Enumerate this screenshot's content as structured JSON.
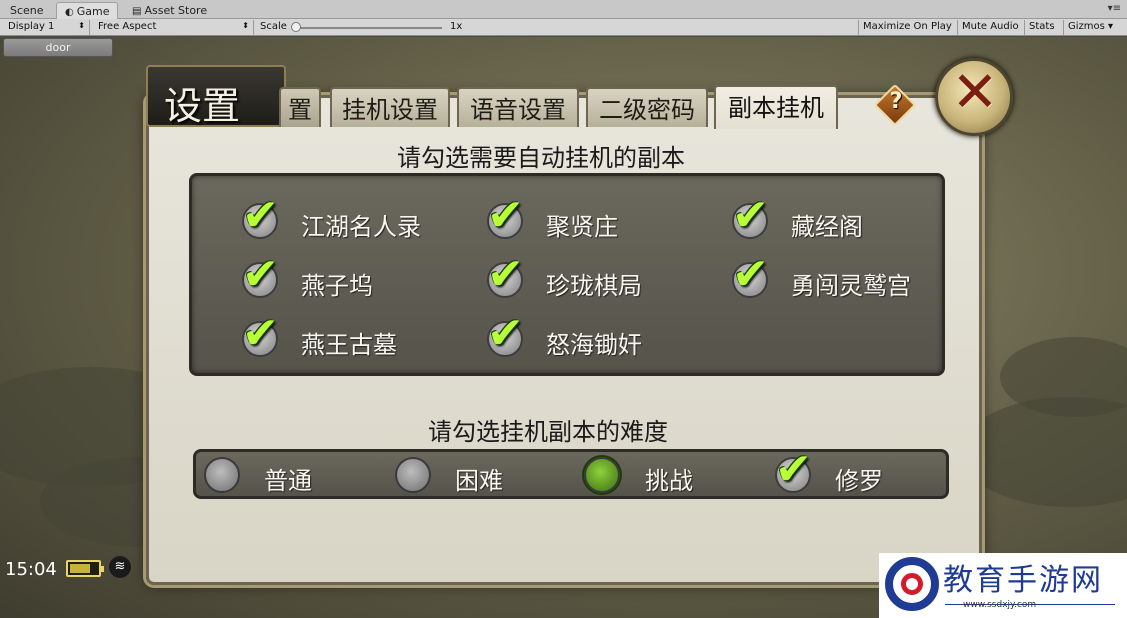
{
  "editor": {
    "tabs": [
      {
        "label": "Scene",
        "icon": "scene-icon"
      },
      {
        "label": "Game",
        "icon": "game-icon",
        "active": true
      },
      {
        "label": "Asset Store",
        "icon": "store-icon"
      }
    ],
    "toolbar": {
      "display": "Display 1",
      "aspect": "Free Aspect",
      "scale_label": "Scale",
      "scale_value": "1x",
      "buttons": [
        "Maximize On Play",
        "Mute Audio",
        "Stats",
        "Gizmos"
      ]
    }
  },
  "game": {
    "door_button": "door",
    "title": "设置",
    "tabs": [
      "置",
      "挂机设置",
      "语音设置",
      "二级密码",
      "副本挂机"
    ],
    "active_tab": "副本挂机",
    "help_label": "?",
    "close_label": "✕",
    "dungeon_heading": "请勾选需要自动挂机的副本",
    "dungeons": [
      {
        "label": "江湖名人录",
        "checked": true
      },
      {
        "label": "聚贤庄",
        "checked": true
      },
      {
        "label": "藏经阁",
        "checked": true
      },
      {
        "label": "燕子坞",
        "checked": true
      },
      {
        "label": "珍珑棋局",
        "checked": true
      },
      {
        "label": "勇闯灵鹫宫",
        "checked": true
      },
      {
        "label": "燕王古墓",
        "checked": true
      },
      {
        "label": "怒海锄奸",
        "checked": true
      }
    ],
    "difficulty_heading": "请勾选挂机副本的难度",
    "difficulties": [
      {
        "label": "普通",
        "state": "off"
      },
      {
        "label": "困难",
        "state": "off"
      },
      {
        "label": "挑战",
        "state": "selected"
      },
      {
        "label": "修罗",
        "state": "checked"
      }
    ],
    "status": {
      "time": "15:04",
      "battery_level": 0.75
    }
  },
  "watermark": {
    "title": "教育手游网",
    "url": "www.ssdxjy.com"
  },
  "colors": {
    "check_green": "#b8ff3a",
    "panel_bg": "#e4e1d4",
    "box_bg": "#5f5d53",
    "close_red": "#7a1e12"
  }
}
